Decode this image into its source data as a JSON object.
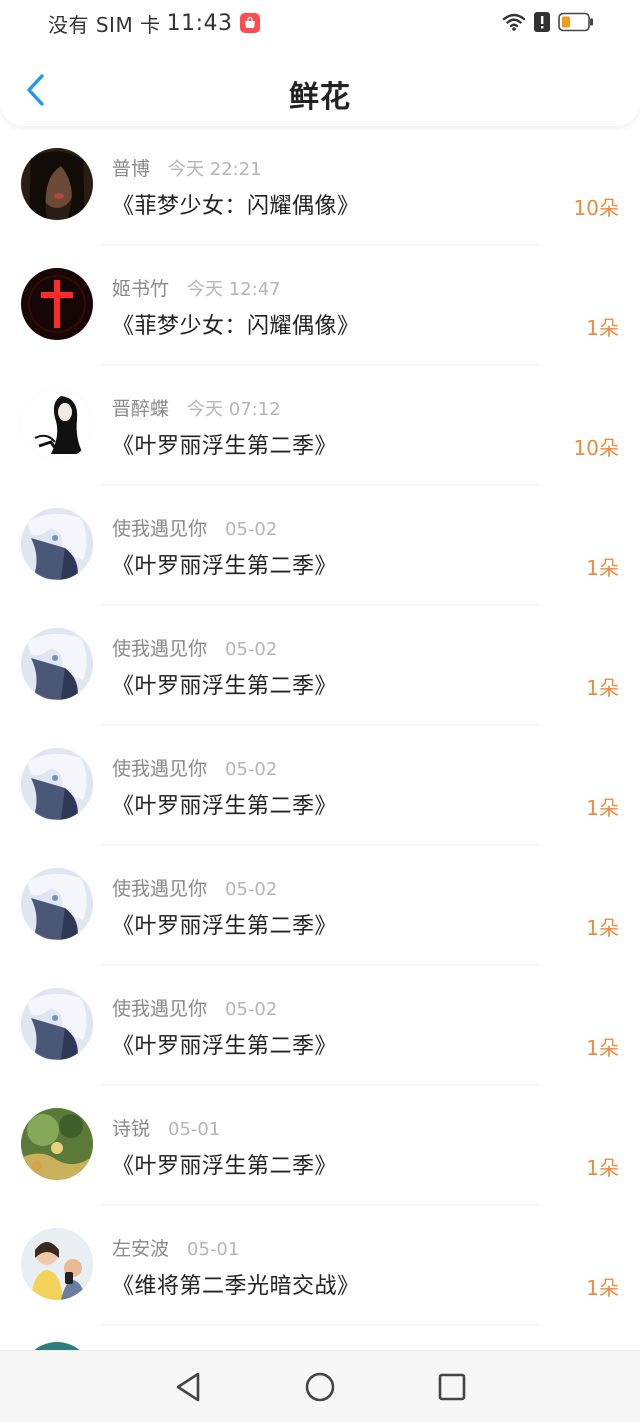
{
  "status": {
    "carrier": "没有 SIM 卡",
    "time": "11:43",
    "icons": [
      "shopping-app-icon",
      "wifi-icon",
      "alert-icon",
      "battery-icon"
    ],
    "battery_color": "#f39a1d"
  },
  "header": {
    "title": "鲜花",
    "back_icon": "chevron-left-icon",
    "accent": "#2196f3"
  },
  "items": [
    {
      "name": "普博",
      "time": "今天 22:21",
      "book": "《菲梦少女：闪耀偶像》",
      "count": "10朵",
      "avatar": "avatar-dark-portrait"
    },
    {
      "name": "姬书竹",
      "time": "今天 12:47",
      "book": "《菲梦少女：闪耀偶像》",
      "count": "1朵",
      "avatar": "avatar-red-cross"
    },
    {
      "name": "晋醉蝶",
      "time": "今天 07:12",
      "book": "《叶罗丽浮生第二季》",
      "count": "10朵",
      "avatar": "avatar-ink-sketch"
    },
    {
      "name": "使我遇见你",
      "time": "05-02",
      "book": "《叶罗丽浮生第二季》",
      "count": "1朵",
      "avatar": "avatar-anime-blue"
    },
    {
      "name": "使我遇见你",
      "time": "05-02",
      "book": "《叶罗丽浮生第二季》",
      "count": "1朵",
      "avatar": "avatar-anime-blue"
    },
    {
      "name": "使我遇见你",
      "time": "05-02",
      "book": "《叶罗丽浮生第二季》",
      "count": "1朵",
      "avatar": "avatar-anime-blue"
    },
    {
      "name": "使我遇见你",
      "time": "05-02",
      "book": "《叶罗丽浮生第二季》",
      "count": "1朵",
      "avatar": "avatar-anime-blue"
    },
    {
      "name": "使我遇见你",
      "time": "05-02",
      "book": "《叶罗丽浮生第二季》",
      "count": "1朵",
      "avatar": "avatar-anime-blue"
    },
    {
      "name": "诗锐",
      "time": "05-01",
      "book": "《叶罗丽浮生第二季》",
      "count": "1朵",
      "avatar": "avatar-green-nature"
    },
    {
      "name": "左安波",
      "time": "05-01",
      "book": "《维将第二季光暗交战》",
      "count": "1朵",
      "avatar": "avatar-couple-photo"
    }
  ],
  "count_color": "#f08a3c",
  "navbar": {
    "icons": [
      "back-triangle-icon",
      "home-circle-icon",
      "recents-square-icon"
    ]
  }
}
